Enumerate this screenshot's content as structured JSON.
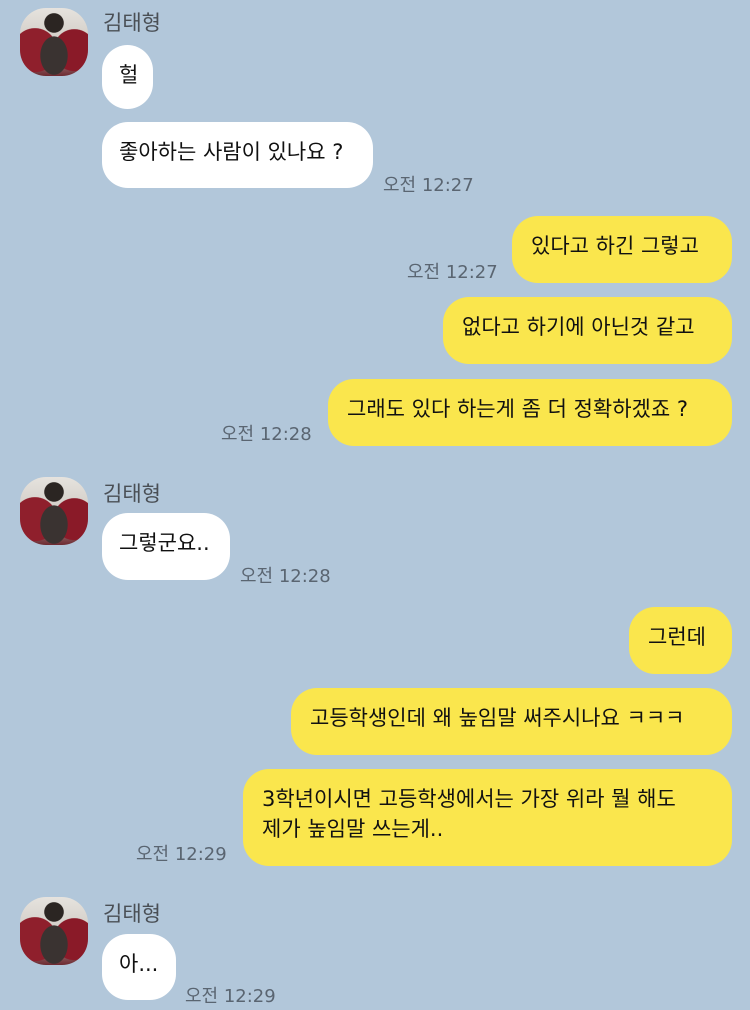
{
  "contact_name": "김태형",
  "messages": {
    "m1": "헐",
    "m2": "좋아하는 사람이 있나요 ?",
    "m3": "있다고 하긴 그렇고",
    "m4": "없다고 하기에 아닌것 같고",
    "m5": "그래도 있다 하는게 좀 더 정확하겠죠 ?",
    "m6": "그렇군요..",
    "m7": "그런데",
    "m8": "고등학생인데 왜 높임말 써주시나요 ㅋㅋㅋ",
    "m9_line1": "3학년이시면 고등학생에서는 가장 위라 뭘 해도",
    "m9_line2": "제가 높임말 쓰는게..",
    "m10": "아..."
  },
  "times": {
    "t1": "오전 12:27",
    "t2": "오전 12:27",
    "t3": "오전 12:28",
    "t4": "오전 12:28",
    "t5": "오전 12:29",
    "t6": "오전 12:29"
  },
  "colors": {
    "background": "#b2c7da",
    "incoming_bubble": "#ffffff",
    "outgoing_bubble": "#fae64d"
  }
}
